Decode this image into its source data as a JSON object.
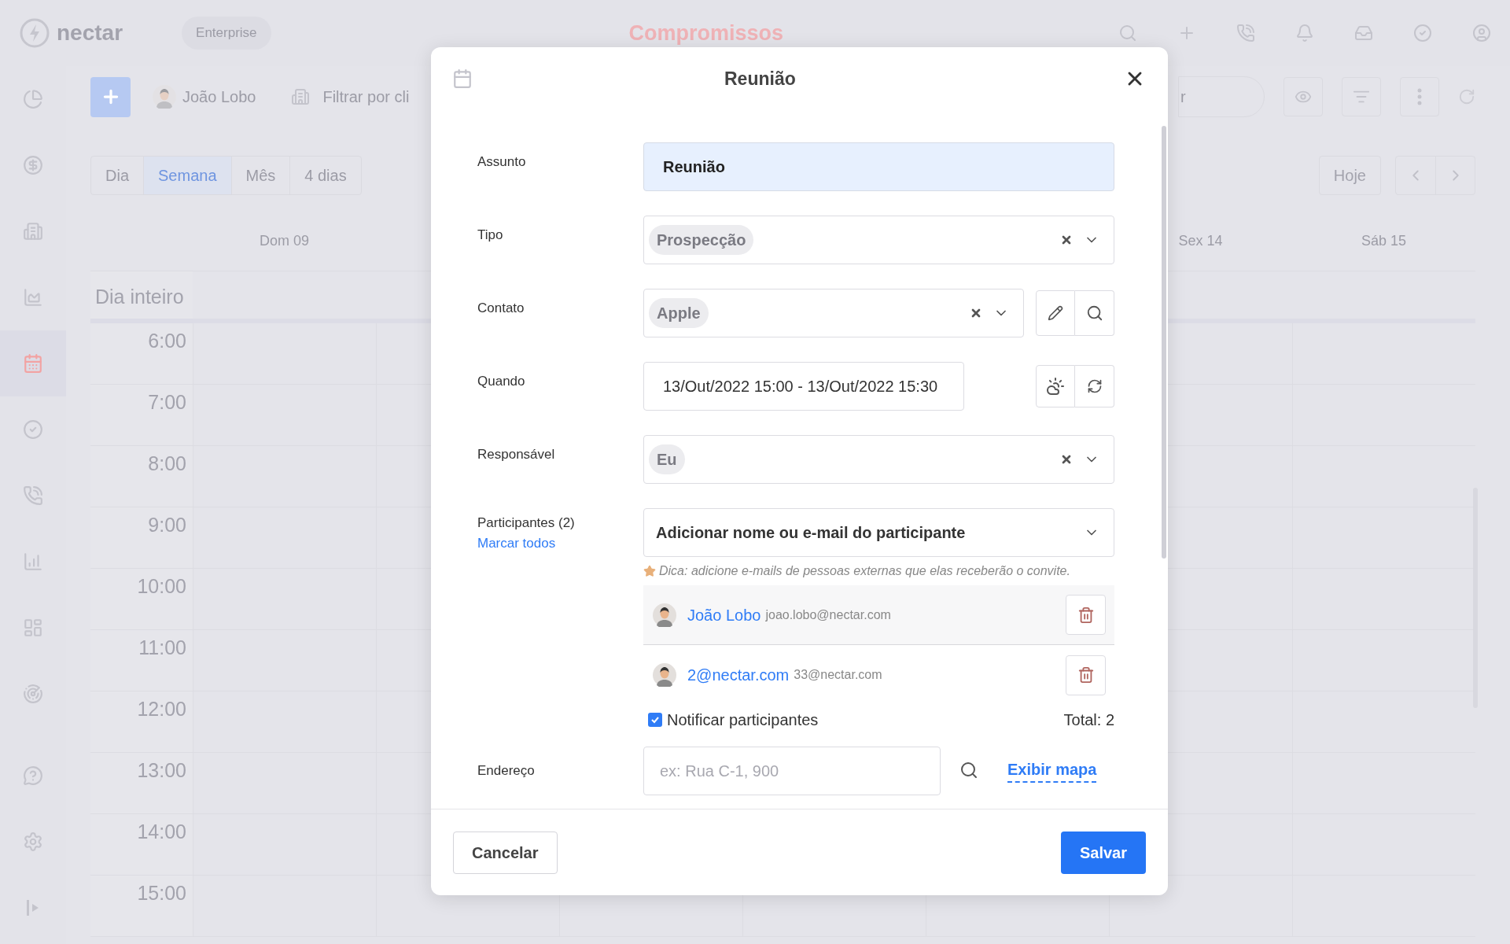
{
  "app": {
    "logo": "nectar",
    "plan": "Enterprise",
    "title": "Compromissos"
  },
  "sidebar": {
    "items": [
      {
        "selected": false
      },
      {
        "selected": false
      },
      {
        "selected": false
      },
      {
        "selected": false
      },
      {
        "selected": true
      },
      {
        "selected": false
      },
      {
        "selected": false
      },
      {
        "selected": false
      },
      {
        "selected": false
      },
      {
        "selected": false
      },
      {
        "selected": false
      },
      {
        "selected": false
      },
      {
        "selected": false
      }
    ]
  },
  "toolbar": {
    "user": "João Lobo",
    "filter_placeholder": "Filtrar por cli",
    "search_fragment": "r"
  },
  "view_tabs": [
    {
      "label": "Dia",
      "selected": false
    },
    {
      "label": "Semana",
      "selected": true
    },
    {
      "label": "Mês",
      "selected": false
    },
    {
      "label": "4 dias",
      "selected": false
    }
  ],
  "today_button": "Hoje",
  "day_headers": [
    "Dom 09",
    "Sex 14",
    "Sáb 15"
  ],
  "all_day": "Dia inteiro",
  "hours": [
    "6:00",
    "7:00",
    "8:00",
    "9:00",
    "10:00",
    "11:00",
    "12:00",
    "13:00",
    "14:00",
    "15:00"
  ],
  "modal": {
    "title": "Reunião",
    "fields": [
      {
        "kind": "text",
        "label": "Assunto",
        "value": "Reunião"
      },
      {
        "kind": "select",
        "label": "Tipo",
        "chip": "Prospecção"
      },
      {
        "kind": "contact",
        "label": "Contato",
        "chip": "Apple"
      },
      {
        "kind": "daterange",
        "label": "Quando",
        "value": "13/Out/2022 15:00 - 13/Out/2022 15:30"
      },
      {
        "kind": "select",
        "label": "Responsável",
        "chip": "Eu"
      }
    ],
    "participants": {
      "label": "Participantes (2)",
      "mark_all": "Marcar todos",
      "prompt": "Adicionar nome ou e-mail do participante",
      "hint": "Dica: adicione e-mails de pessoas externas que elas receberão o convite.",
      "list": [
        {
          "name": "João Lobo",
          "email": "joao.lobo@nectar.com",
          "highlighted": true
        },
        {
          "name": "2@nectar.com",
          "email": "33@nectar.com",
          "highlighted": false
        }
      ],
      "notify": {
        "label": "Notificar participantes",
        "checked": true
      },
      "total": "Total: 2"
    },
    "address": {
      "label": "Endereço",
      "placeholder": "ex: Rua C-1, 900",
      "map_link": "Exibir mapa"
    },
    "cancel": "Cancelar",
    "save": "Salvar"
  }
}
